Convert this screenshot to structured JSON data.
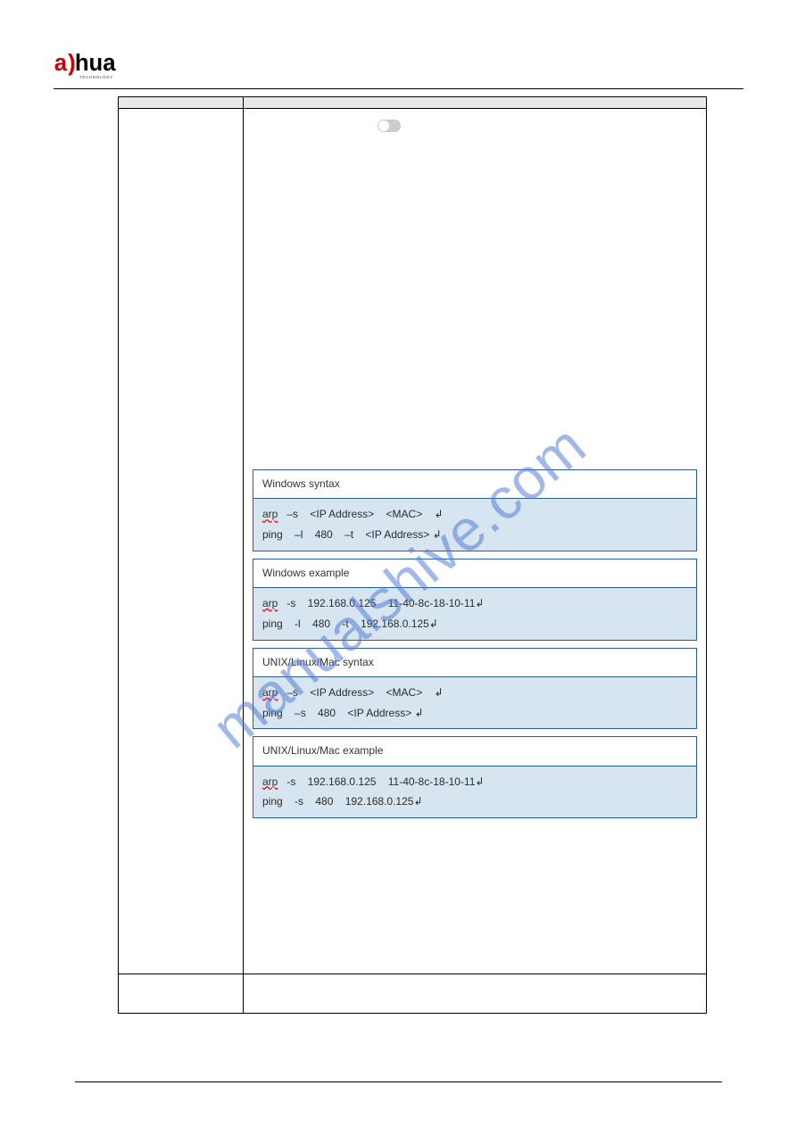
{
  "brand": {
    "name": "alhua",
    "subtitle": "TECHNOLOGY"
  },
  "watermark": "manualshive.com",
  "table": {
    "header": {
      "param": "",
      "desc": ""
    },
    "row1": {
      "param": "",
      "toggle_hint": "",
      "code_blocks": {
        "win_syntax_title": "Windows syntax",
        "win_syntax_body": "arp   –s    <IP Address>    <MAC>    \nping    –l    480    –t    <IP Address> ",
        "win_example_title": "Windows example",
        "win_example_body": "arp   -s    192.168.0.125    11-40-8c-18-10-11\nping    -l    480    -t    192.168.0.125",
        "unix_syntax_title": "UNIX/Linux/Mac syntax",
        "unix_syntax_body": "arp   –s    <IP Address>    <MAC>    \nping    –s    480    <IP Address> ",
        "unix_example_title": "UNIX/Linux/Mac example",
        "unix_example_body": "arp   -s    192.168.0.125    11-40-8c-18-10-11\nping    -s    480    192.168.0.125"
      }
    },
    "row2": {
      "param": "",
      "desc": ""
    }
  },
  "footer": {
    "left": "",
    "right": ""
  }
}
